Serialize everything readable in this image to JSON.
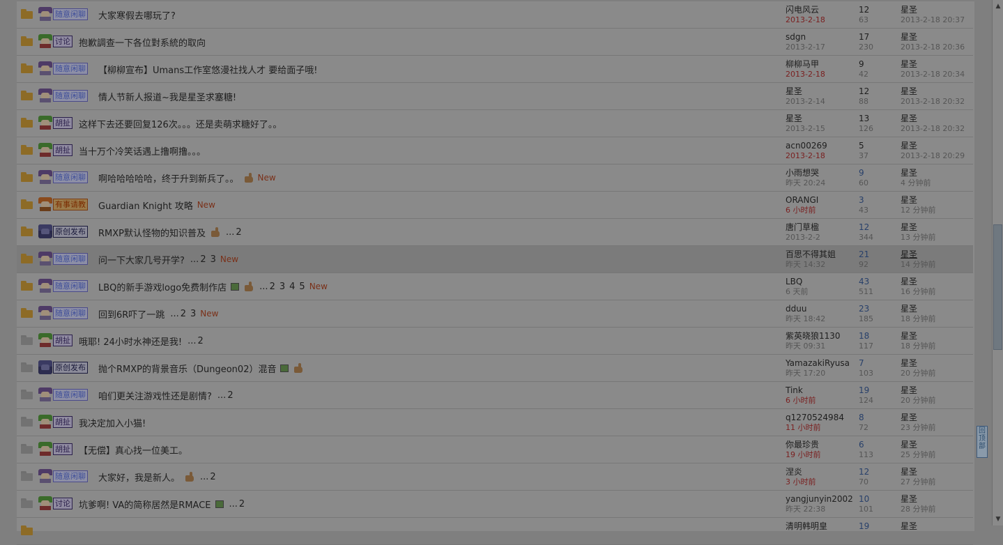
{
  "threads": [
    {
      "folder": "new",
      "avatar": "purple",
      "tag": "随意闲聊",
      "tag_style": "blue",
      "title": "大家寒假去哪玩了?",
      "pages": [],
      "thumb": false,
      "img": false,
      "new": false,
      "author": "闪电风云",
      "date": "2013-2-18",
      "date_red": true,
      "replies": "12",
      "views": "63",
      "last_user": "星圣",
      "last_time": "2013-2-18 20:37"
    },
    {
      "folder": "new",
      "avatar": "green",
      "tag": "讨论",
      "tag_style": "purple",
      "title": "抱歉調查一下各位對系統的取向",
      "pages": [],
      "thumb": false,
      "img": false,
      "new": false,
      "author": "sdgn",
      "date": "2013-2-17",
      "date_red": false,
      "replies": "17",
      "views": "230",
      "last_user": "星圣",
      "last_time": "2013-2-18 20:36"
    },
    {
      "folder": "new",
      "avatar": "purple",
      "tag": "随意闲聊",
      "tag_style": "blue",
      "title": "【柳柳宣布】Umans工作室悠漫社找人才 要给面子哦!",
      "pages": [],
      "thumb": false,
      "img": false,
      "new": false,
      "author": "柳柳马甲",
      "date": "2013-2-18",
      "date_red": true,
      "replies": "9",
      "views": "42",
      "last_user": "星圣",
      "last_time": "2013-2-18 20:34"
    },
    {
      "folder": "new",
      "avatar": "purple",
      "tag": "随意闲聊",
      "tag_style": "blue",
      "title": "情人节新人报道~我是星圣求塞糖!",
      "pages": [],
      "thumb": false,
      "img": false,
      "new": false,
      "author": "星圣",
      "date": "2013-2-14",
      "date_red": false,
      "replies": "12",
      "views": "88",
      "last_user": "星圣",
      "last_time": "2013-2-18 20:32"
    },
    {
      "folder": "new",
      "avatar": "green",
      "tag": "胡扯",
      "tag_style": "purple",
      "title": "这样下去还要回复126次。。。还是卖萌求糖好了。。",
      "pages": [],
      "thumb": false,
      "img": false,
      "new": false,
      "author": "星圣",
      "date": "2013-2-15",
      "date_red": false,
      "replies": "13",
      "views": "126",
      "last_user": "星圣",
      "last_time": "2013-2-18 20:32"
    },
    {
      "folder": "new",
      "avatar": "green",
      "tag": "胡扯",
      "tag_style": "purple",
      "title": "当十万个冷笑话遇上撸啊撸。。。",
      "pages": [],
      "thumb": false,
      "img": false,
      "new": false,
      "author": "acn00269",
      "date": "2013-2-18",
      "date_red": true,
      "replies": "5",
      "views": "37",
      "last_user": "星圣",
      "last_time": "2013-2-18 20:29"
    },
    {
      "folder": "new",
      "avatar": "purple",
      "tag": "随意闲聊",
      "tag_style": "blue",
      "title": "啊哈哈哈哈哈，终于升到新兵了。。",
      "pages": [],
      "thumb": true,
      "img": false,
      "new": true,
      "author": "小雨想哭",
      "date": "昨天 20:24",
      "date_red": false,
      "replies": "9",
      "replies_blue": true,
      "views": "60",
      "last_user": "星圣",
      "last_time": "4 分钟前"
    },
    {
      "folder": "new",
      "avatar": "orange",
      "tag": "有事请教",
      "tag_style": "orange",
      "title": "Guardian Knight 攻略",
      "pages": [],
      "thumb": false,
      "img": false,
      "new": true,
      "author": "ORANGI",
      "date": "6 小时前",
      "date_red": true,
      "replies": "3",
      "replies_blue": true,
      "views": "43",
      "last_user": "星圣",
      "last_time": "12 分钟前"
    },
    {
      "folder": "new",
      "avatar": "dark",
      "tag": "原创发布",
      "tag_style": "navy",
      "title": "RMXP默认怪物的知识普及",
      "pages": [
        "2"
      ],
      "thumb": true,
      "img": false,
      "new": false,
      "author": "唐门草楹",
      "date": "2013-2-2",
      "date_red": false,
      "replies": "12",
      "replies_blue": true,
      "views": "344",
      "last_user": "星圣",
      "last_time": "13 分钟前"
    },
    {
      "folder": "new",
      "avatar": "purple",
      "tag": "随意闲聊",
      "tag_style": "blue",
      "title": "问一下大家几号开学?",
      "pages": [
        "2",
        "3"
      ],
      "thumb": false,
      "img": false,
      "new": true,
      "author": "百思不得其姐",
      "date": "昨天 14:32",
      "date_red": false,
      "replies": "21",
      "replies_blue": true,
      "views": "92",
      "last_user": "星圣",
      "last_underline": true,
      "last_time": "14 分钟前",
      "highlight": true
    },
    {
      "folder": "new",
      "avatar": "purple",
      "tag": "随意闲聊",
      "tag_style": "blue",
      "title": "LBQ的新手游戏logo免费制作店",
      "pages": [
        "2",
        "3",
        "4",
        "5"
      ],
      "thumb": true,
      "img": true,
      "new": true,
      "author": "LBQ",
      "date": "6 天前",
      "date_red": false,
      "replies": "43",
      "replies_blue": true,
      "views": "511",
      "last_user": "星圣",
      "last_time": "16 分钟前"
    },
    {
      "folder": "new",
      "avatar": "purple",
      "tag": "随意闲聊",
      "tag_style": "blue",
      "title": "回到6R吓了一跳",
      "pages": [
        "2",
        "3"
      ],
      "thumb": false,
      "img": false,
      "new": true,
      "author": "dduu",
      "date": "昨天 18:42",
      "date_red": false,
      "replies": "23",
      "replies_blue": true,
      "views": "185",
      "last_user": "星圣",
      "last_time": "18 分钟前"
    },
    {
      "folder": "old",
      "avatar": "green",
      "tag": "胡扯",
      "tag_style": "purple",
      "title": "哦耶! 24小时水神还是我!",
      "pages": [
        "2"
      ],
      "thumb": false,
      "img": false,
      "new": false,
      "author": "紫英晓狼1130",
      "date": "昨天 09:31",
      "date_red": false,
      "replies": "18",
      "replies_blue": true,
      "views": "117",
      "last_user": "星圣",
      "last_time": "18 分钟前"
    },
    {
      "folder": "old",
      "avatar": "dark",
      "tag": "原创发布",
      "tag_style": "navy",
      "title": "抛个RMXP的背景音乐（Dungeon02）混音",
      "pages": [],
      "thumb": true,
      "img": true,
      "new": false,
      "author": "YamazakiRyusa",
      "date": "昨天 17:20",
      "date_red": false,
      "replies": "7",
      "replies_blue": true,
      "views": "103",
      "last_user": "星圣",
      "last_time": "20 分钟前"
    },
    {
      "folder": "old",
      "avatar": "purple",
      "tag": "随意闲聊",
      "tag_style": "blue",
      "title": "咱们更关注游戏性还是剧情?",
      "pages": [
        "2"
      ],
      "thumb": false,
      "img": false,
      "new": false,
      "author": "Tink",
      "date": "6 小时前",
      "date_red": true,
      "replies": "19",
      "replies_blue": true,
      "views": "124",
      "last_user": "星圣",
      "last_time": "20 分钟前"
    },
    {
      "folder": "old",
      "avatar": "green",
      "tag": "胡扯",
      "tag_style": "purple",
      "title": "我决定加入小猫!",
      "pages": [],
      "thumb": false,
      "img": false,
      "new": false,
      "author": "q1270524984",
      "date": "11 小时前",
      "date_red": true,
      "replies": "8",
      "replies_blue": true,
      "views": "72",
      "last_user": "星圣",
      "last_time": "23 分钟前"
    },
    {
      "folder": "old",
      "avatar": "green",
      "tag": "胡扯",
      "tag_style": "purple",
      "title": "【无偿】真心找一位美工。",
      "pages": [],
      "thumb": false,
      "img": false,
      "new": false,
      "author": "你最珍贵",
      "date": "19 小时前",
      "date_red": true,
      "replies": "6",
      "replies_blue": true,
      "views": "113",
      "last_user": "星圣",
      "last_time": "25 分钟前"
    },
    {
      "folder": "old",
      "avatar": "purple",
      "tag": "随意闲聊",
      "tag_style": "blue",
      "title": "大家好，我是新人。",
      "pages": [
        "2"
      ],
      "thumb": true,
      "img": false,
      "new": false,
      "author": "涅炎",
      "date": "3 小时前",
      "date_red": true,
      "replies": "12",
      "replies_blue": true,
      "views": "70",
      "last_user": "星圣",
      "last_time": "27 分钟前"
    },
    {
      "folder": "old",
      "avatar": "green",
      "tag": "讨论",
      "tag_style": "purple",
      "title": "坑爹啊! VA的简称居然是RMACE",
      "pages": [
        "2"
      ],
      "thumb": false,
      "img": true,
      "new": false,
      "author": "yangjunyin2002",
      "date": "昨天 22:38",
      "date_red": false,
      "replies": "10",
      "replies_blue": true,
      "views": "101",
      "last_user": "星圣",
      "last_time": "28 分钟前"
    },
    {
      "folder": "new",
      "avatar": "green",
      "tag": "",
      "tag_style": "purple",
      "title": "",
      "pages": [],
      "thumb": false,
      "img": false,
      "new": false,
      "author": "清明韩明皇",
      "date": "",
      "date_red": false,
      "replies": "19",
      "replies_blue": true,
      "views": "",
      "last_user": "星圣",
      "last_time": ""
    }
  ],
  "labels": {
    "new": "New",
    "ellipsis": "...",
    "back_to_top": "回顶部"
  },
  "colors": {
    "overlay": "#7f7f7f",
    "new_label": "#7a3018",
    "date_red": "#7a2020",
    "reply_blue": "#28406a"
  },
  "icons": {
    "folder_new": "folder-icon",
    "folder_old": "folder-icon",
    "thumb": "thumbs-up-icon",
    "image": "image-attachment-icon",
    "scroll_up": "chevron-up-icon",
    "scroll_down": "chevron-down-icon"
  }
}
